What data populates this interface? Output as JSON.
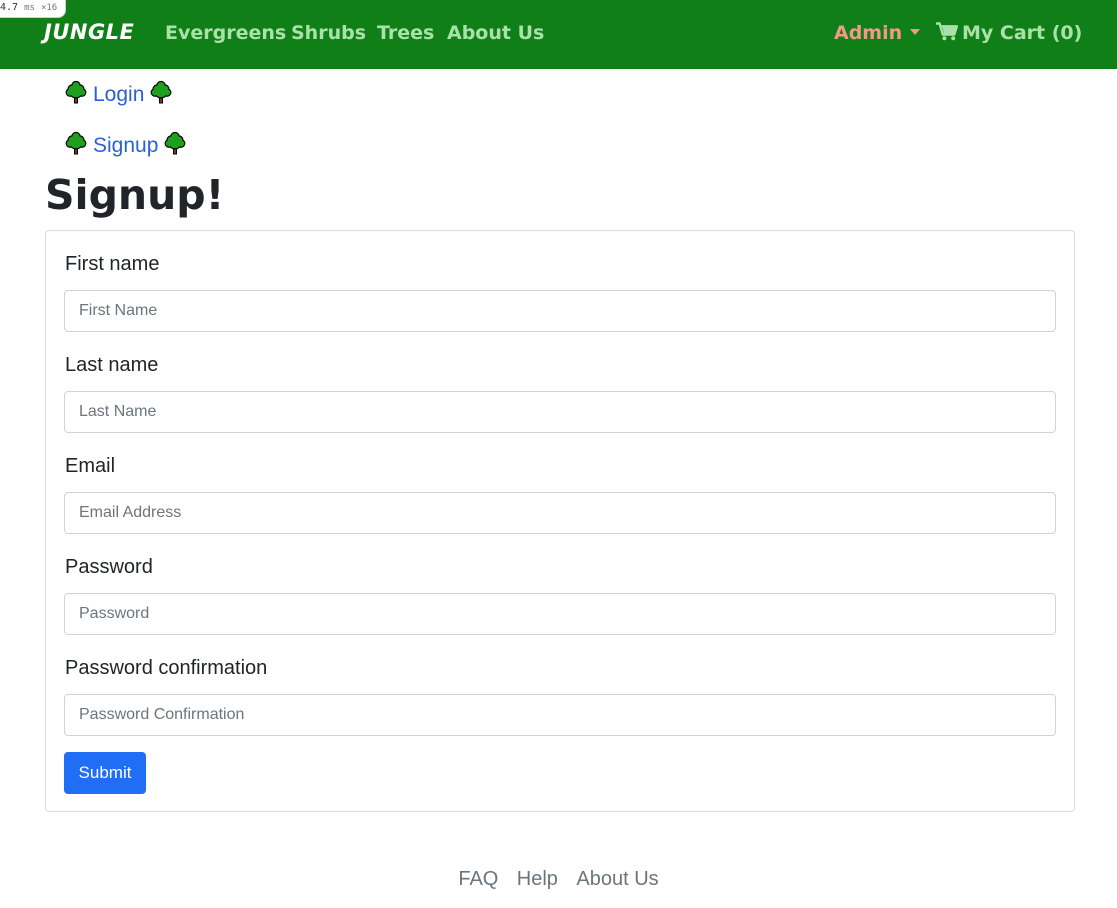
{
  "perf_badge": {
    "time": "4.7",
    "unit": "ms",
    "count": "×16"
  },
  "navbar": {
    "brand": "JUNGLE",
    "links": [
      "Evergreens",
      "Shrubs",
      "Trees",
      "About Us"
    ],
    "admin_label": "Admin",
    "cart_label": "My Cart (0)"
  },
  "auth_links": {
    "login": "Login",
    "signup": "Signup"
  },
  "page_title": "Signup!",
  "form": {
    "fields": [
      {
        "label": "First name",
        "placeholder": "First Name",
        "value": ""
      },
      {
        "label": "Last name",
        "placeholder": "Last Name",
        "value": ""
      },
      {
        "label": "Email",
        "placeholder": "Email Address",
        "value": ""
      },
      {
        "label": "Password",
        "placeholder": "Password",
        "value": ""
      },
      {
        "label": "Password confirmation",
        "placeholder": "Password Confirmation",
        "value": ""
      }
    ],
    "submit_label": "Submit"
  },
  "footer": {
    "links": [
      "FAQ",
      "Help",
      "About Us"
    ]
  },
  "colors": {
    "navbar_bg": "#117f17",
    "nav_link": "#a9e2a9",
    "admin_link": "#ef9a8a",
    "link_blue": "#2b60d8",
    "primary_button": "#1f6ef5",
    "footer_link": "#6c757d"
  },
  "icons": [
    "tree-icon",
    "cart-icon",
    "dropdown-caret-icon"
  ]
}
